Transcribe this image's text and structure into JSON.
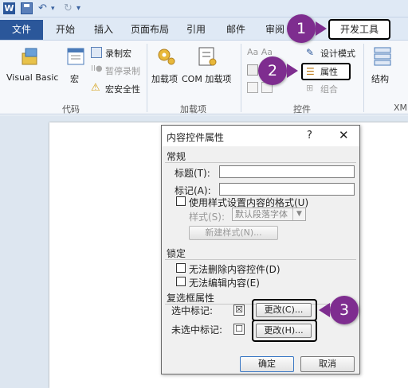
{
  "qat": {
    "word_icon": "W",
    "undo_icon": "undo-icon",
    "redo_icon": "redo-icon"
  },
  "tabs": {
    "file": "文件",
    "items": [
      "开始",
      "插入",
      "页面布局",
      "引用",
      "邮件",
      "审阅"
    ],
    "developer": "开发工具"
  },
  "ribbon": {
    "visual_basic": "Visual Basic",
    "macro": "宏",
    "record_macro": "录制宏",
    "pause_recording": "暂停录制",
    "macro_security": "宏安全性",
    "group_code": "代码",
    "addins": "加载项",
    "com_addins": "COM 加载项",
    "group_addins": "加载项",
    "design_mode": "设计模式",
    "properties": "属性",
    "group_combine": "组合",
    "group_controls": "控件",
    "structure": "结构",
    "xm": "XM"
  },
  "dialog": {
    "title": "内容控件属性",
    "help": "?",
    "close": "✕",
    "general": {
      "header": "常规",
      "title_label": "标题(T):",
      "title_value": "",
      "tag_label": "标记(A):",
      "tag_value": "",
      "use_style_label": "使用样式设置内容的格式(U)",
      "style_label": "样式(S):",
      "style_value": "默认段落字体",
      "new_style": "新建样式(N)..."
    },
    "locking": {
      "header": "锁定",
      "cannot_delete": "无法删除内容控件(D)",
      "cannot_edit": "无法编辑内容(E)"
    },
    "checkbox": {
      "header": "复选框属性",
      "checked_label": "选中标记:",
      "checked_symbol": "☒",
      "unchecked_label": "未选中标记:",
      "unchecked_symbol": "☐",
      "change_checked": "更改(C)...",
      "change_unchecked": "更改(H)..."
    },
    "ok": "确定",
    "cancel": "取消"
  },
  "callouts": [
    "1",
    "2",
    "3"
  ],
  "colors": {
    "accent": "#2b579a",
    "callout": "#7e2d8f"
  }
}
